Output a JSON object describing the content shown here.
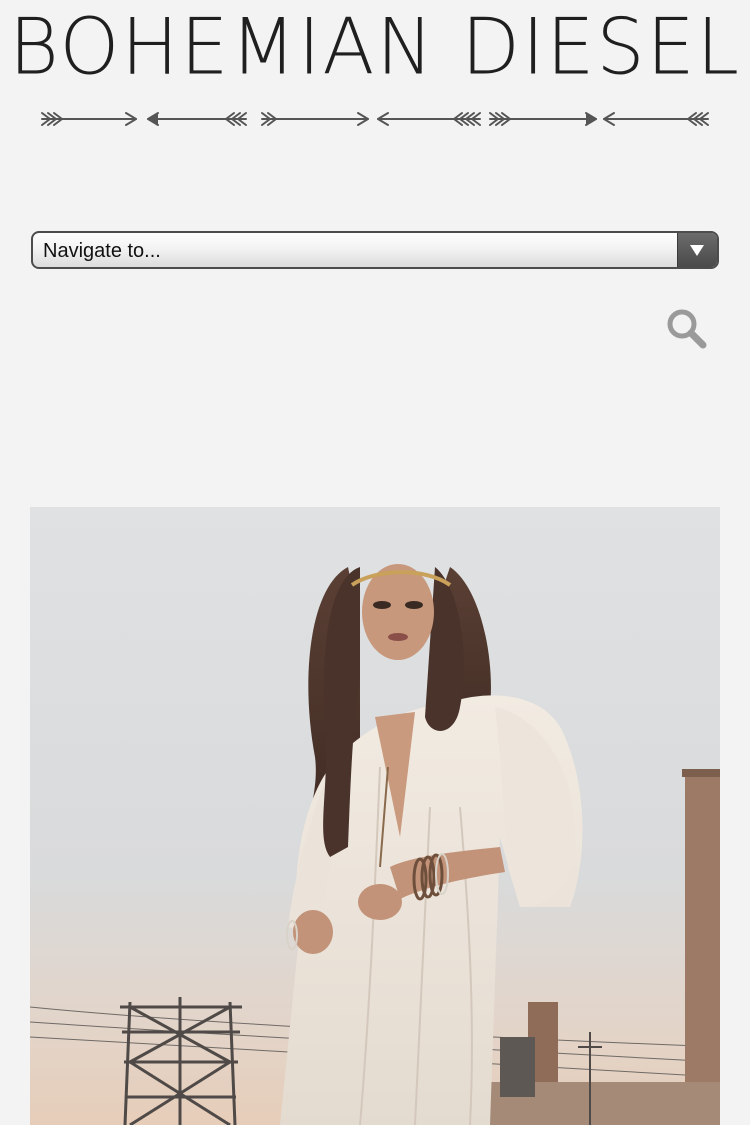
{
  "header": {
    "logo_text": "BOHEMIAN DIESEL"
  },
  "navigation": {
    "select_label": "Navigate to...",
    "arrow_icon": "chevron-down-icon"
  },
  "search": {
    "icon": "search-icon"
  },
  "decor": {
    "divider_icon": "arrow-divider-icon"
  },
  "hero": {
    "icon": "hero-photo"
  },
  "colors": {
    "background": "#f3f3f3",
    "text": "#1f1f1f",
    "select_arrow_bg": "#5a5a5a",
    "search_icon": "#9a9a9a"
  }
}
